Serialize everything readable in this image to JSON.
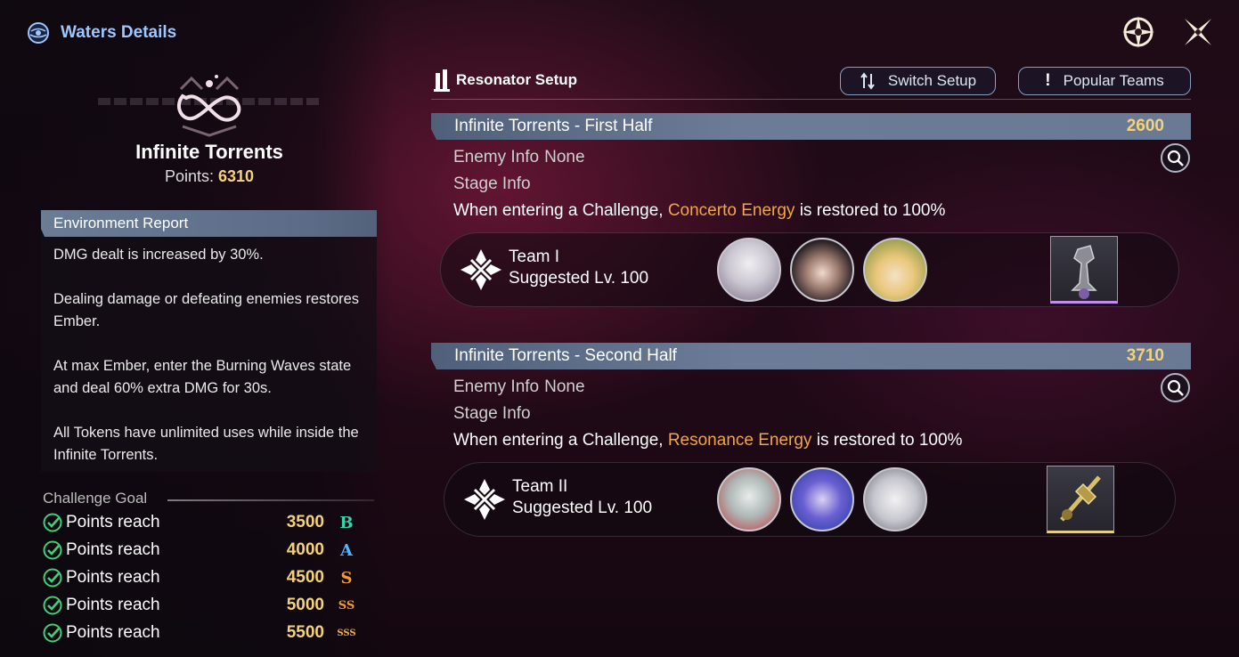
{
  "header": {
    "title": "Waters Details"
  },
  "stage": {
    "name": "Infinite Torrents",
    "points_label": "Points:",
    "points_value": "6310"
  },
  "environment": {
    "title": "Environment Report",
    "paragraphs": [
      "DMG dealt is increased by 30%.",
      "Dealing damage or defeating enemies restores Ember.",
      "At max Ember, enter the Burning Waves state and deal 60% extra DMG for 30s.",
      "All Tokens have unlimited uses while inside the Infinite Torrents."
    ]
  },
  "goals": {
    "title": "Challenge Goal",
    "items": [
      {
        "label": "Points reach",
        "value": "3500",
        "rank": "B",
        "color": "#37d3a8"
      },
      {
        "label": "Points reach",
        "value": "4000",
        "rank": "A",
        "color": "#4fb6ff"
      },
      {
        "label": "Points reach",
        "value": "4500",
        "rank": "S",
        "color": "#f39a3a"
      },
      {
        "label": "Points reach",
        "value": "5000",
        "rank": "SS",
        "color": "#f39a3a"
      },
      {
        "label": "Points reach",
        "value": "5500",
        "rank": "SSS",
        "color": "#f3b23a"
      }
    ]
  },
  "setup": {
    "title": "Resonator Setup",
    "switch_label": "Switch Setup",
    "popular_label": "Popular Teams"
  },
  "halves": [
    {
      "title": "Infinite Torrents - First Half",
      "points": "2600",
      "enemy_label": "Enemy Info",
      "enemy_value": "None",
      "stage_label": "Stage Info",
      "enter_prefix": "When entering a Challenge,",
      "energy": "Concerto Energy",
      "enter_suffix": "is restored to 100%",
      "team_name": "Team I",
      "team_level": "Suggested Lv. 100"
    },
    {
      "title": "Infinite Torrents - Second Half",
      "points": "3710",
      "enemy_label": "Enemy Info",
      "enemy_value": "None",
      "stage_label": "Stage Info",
      "enter_prefix": "When entering a Challenge,",
      "energy": "Resonance Energy",
      "enter_suffix": "is restored to 100%",
      "team_name": "Team II",
      "team_level": "Suggested Lv. 100"
    }
  ],
  "icons": {
    "header": "globe-icon",
    "top_right": [
      "compass-icon",
      "close-icon"
    ],
    "setup": "tower-icon",
    "switch": "swap-arrows-icon",
    "popular": "exclamation-icon",
    "search": "magnify-icon"
  },
  "colors": {
    "accent_blue": "#9ec6ff",
    "gold": "#f5d27a",
    "highlight": "#f0a64a"
  }
}
